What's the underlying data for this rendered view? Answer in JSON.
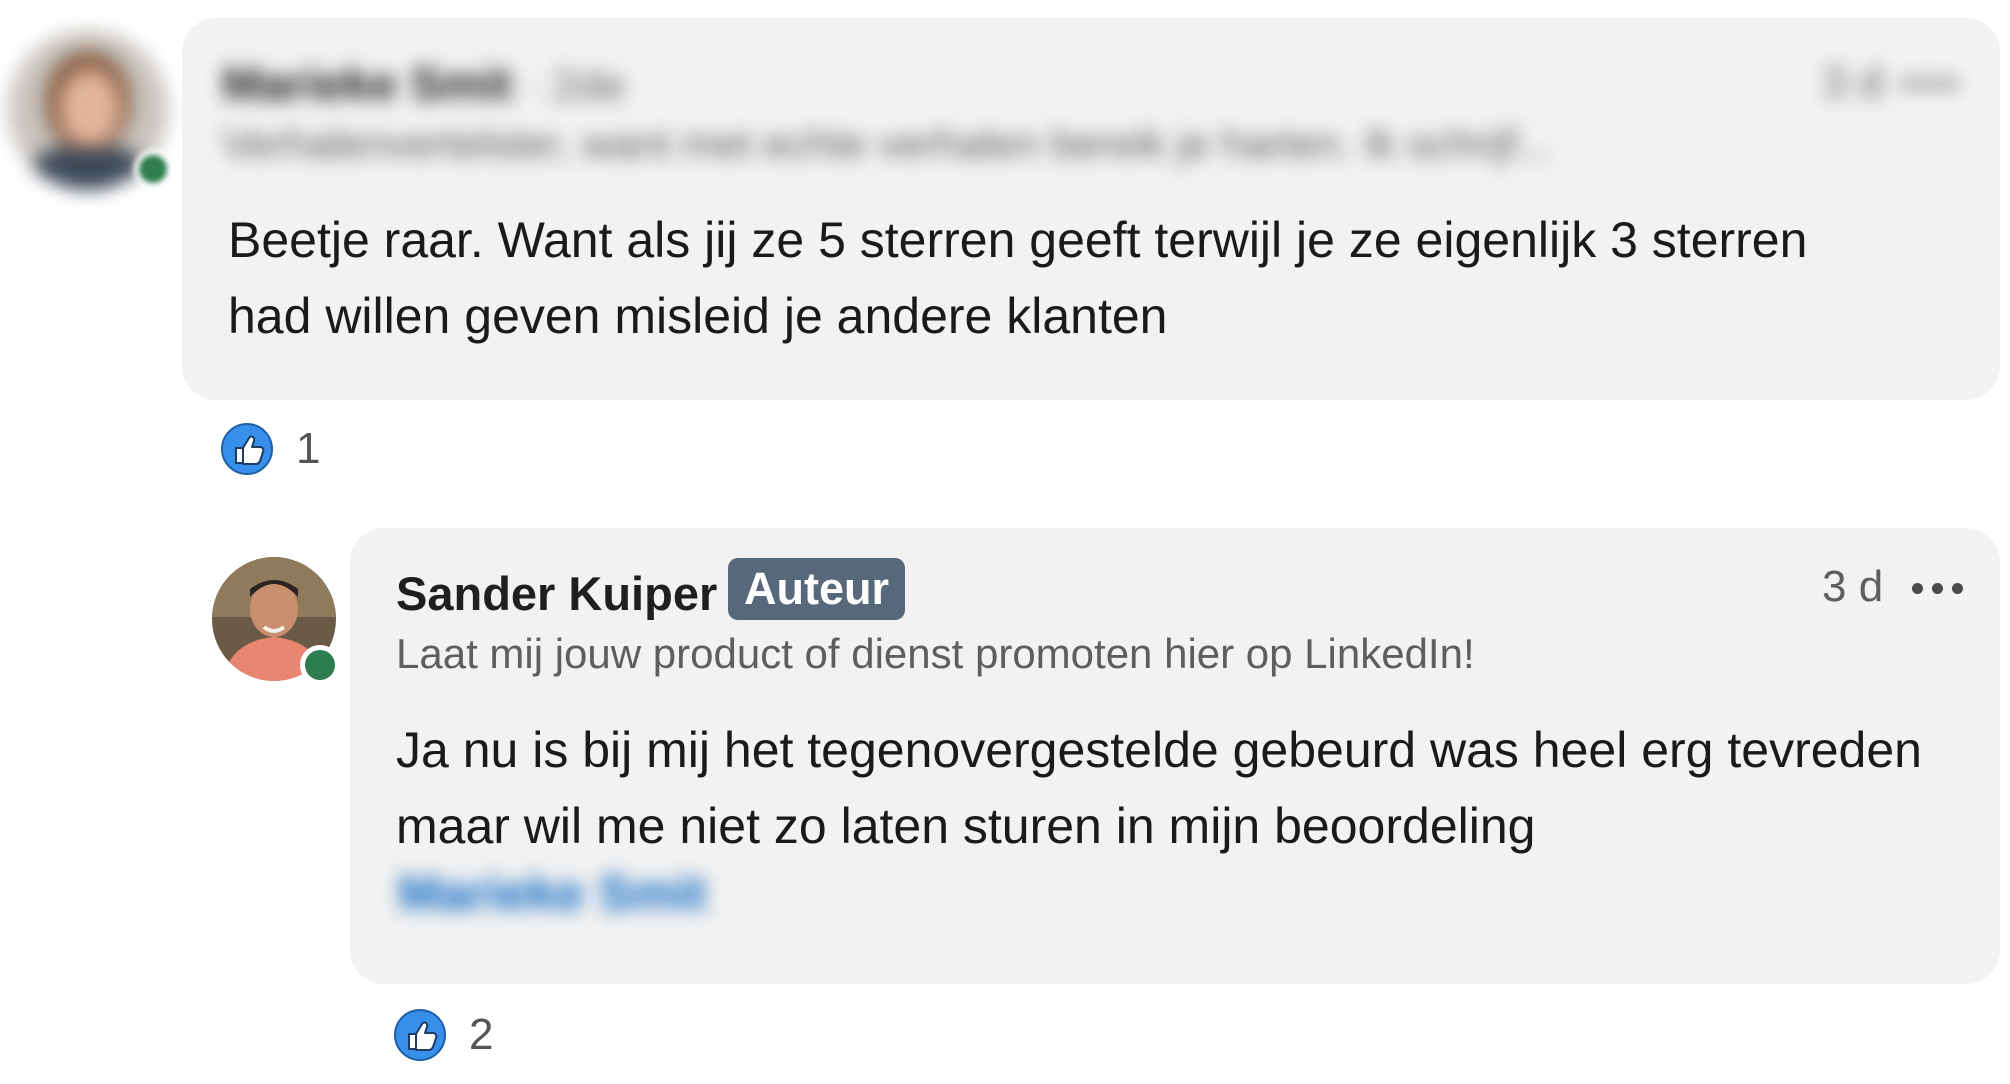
{
  "comment1": {
    "author_blurred": "Marieke Smit",
    "degree_blurred": "· 2de",
    "headline_blurred": "Verhalenvertelster, want met echte verhalen bereik je harten. Ik schrijf...",
    "time_blurred": "3 d",
    "text": "Beetje raar. Want als jij ze 5 sterren geeft terwijl je ze eigenlijk 3 sterren had willen geven misleid je andere klanten",
    "reaction_count": "1"
  },
  "comment2": {
    "author": "Sander Kuiper",
    "badge": "Auteur",
    "headline": "Laat mij jouw product of dienst promoten hier op LinkedIn!",
    "time": "3 d",
    "text": "Ja nu is bij mij het tegenovergestelde gebeurd was heel erg tevreden maar wil me niet zo laten sturen in mijn beoordeling",
    "mention_blurred": "Marieke Smit",
    "reaction_count": "2"
  },
  "icons": {
    "like": "thumbs-up-icon",
    "more": "more-options-icon",
    "presence": "online-status-icon"
  },
  "colors": {
    "bubble": "#f2f2f2",
    "badge": "#56687a",
    "presence": "#2e7d4f",
    "like": "#378fe9",
    "mention": "#0a66c2"
  }
}
